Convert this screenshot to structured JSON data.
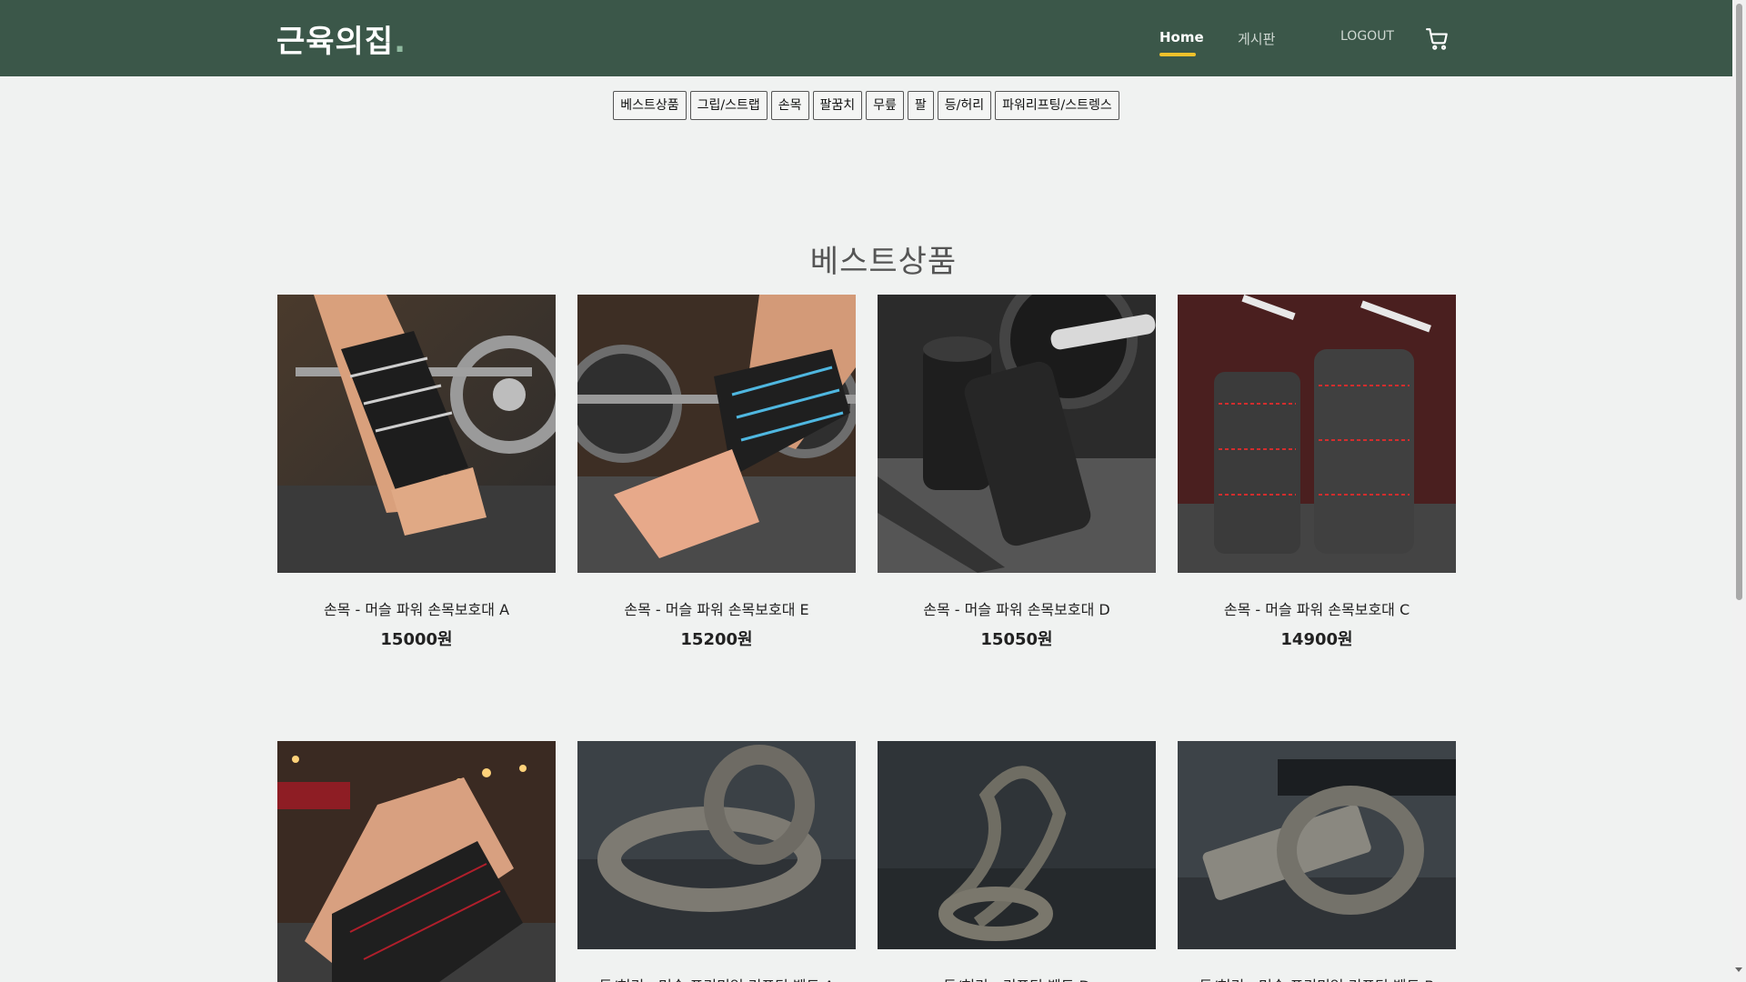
{
  "header": {
    "logo_text": "근육의집",
    "logo_dot": ".",
    "nav": {
      "home": "Home",
      "board": "게시판",
      "logout": "LOGOUT"
    },
    "cart_icon": "cart-icon"
  },
  "categories": [
    "베스트상품",
    "그립/스트랩",
    "손목",
    "팔꿈치",
    "무릎",
    "팔",
    "등/허리",
    "파워리프팅/스트렝스"
  ],
  "section": {
    "title": "베스트상품"
  },
  "products_row1": [
    {
      "name": "손목 - 머슬 파워 손목보호대 A",
      "price": "15000원"
    },
    {
      "name": "손목 - 머슬 파워 손목보호대 E",
      "price": "15200원"
    },
    {
      "name": "손목 - 머슬 파워 손목보호대 D",
      "price": "15050원"
    },
    {
      "name": "손목 - 머슬 파워 손목보호대 C",
      "price": "14900원"
    }
  ],
  "products_row2": [
    {
      "name": "",
      "price": ""
    },
    {
      "name": "등/허리 - 머슬 프리미엄 리프팅 벨트 A",
      "price": ""
    },
    {
      "name": "등/허리 - 리프팅 벨트 D",
      "price": ""
    },
    {
      "name": "등/허리 - 머슬 프리미엄 리프팅 벨트 B",
      "price": ""
    }
  ],
  "colors": {
    "header_bg": "#3b5749",
    "accent_underline": "#f0c12b",
    "page_bg": "#f0f2f1"
  }
}
